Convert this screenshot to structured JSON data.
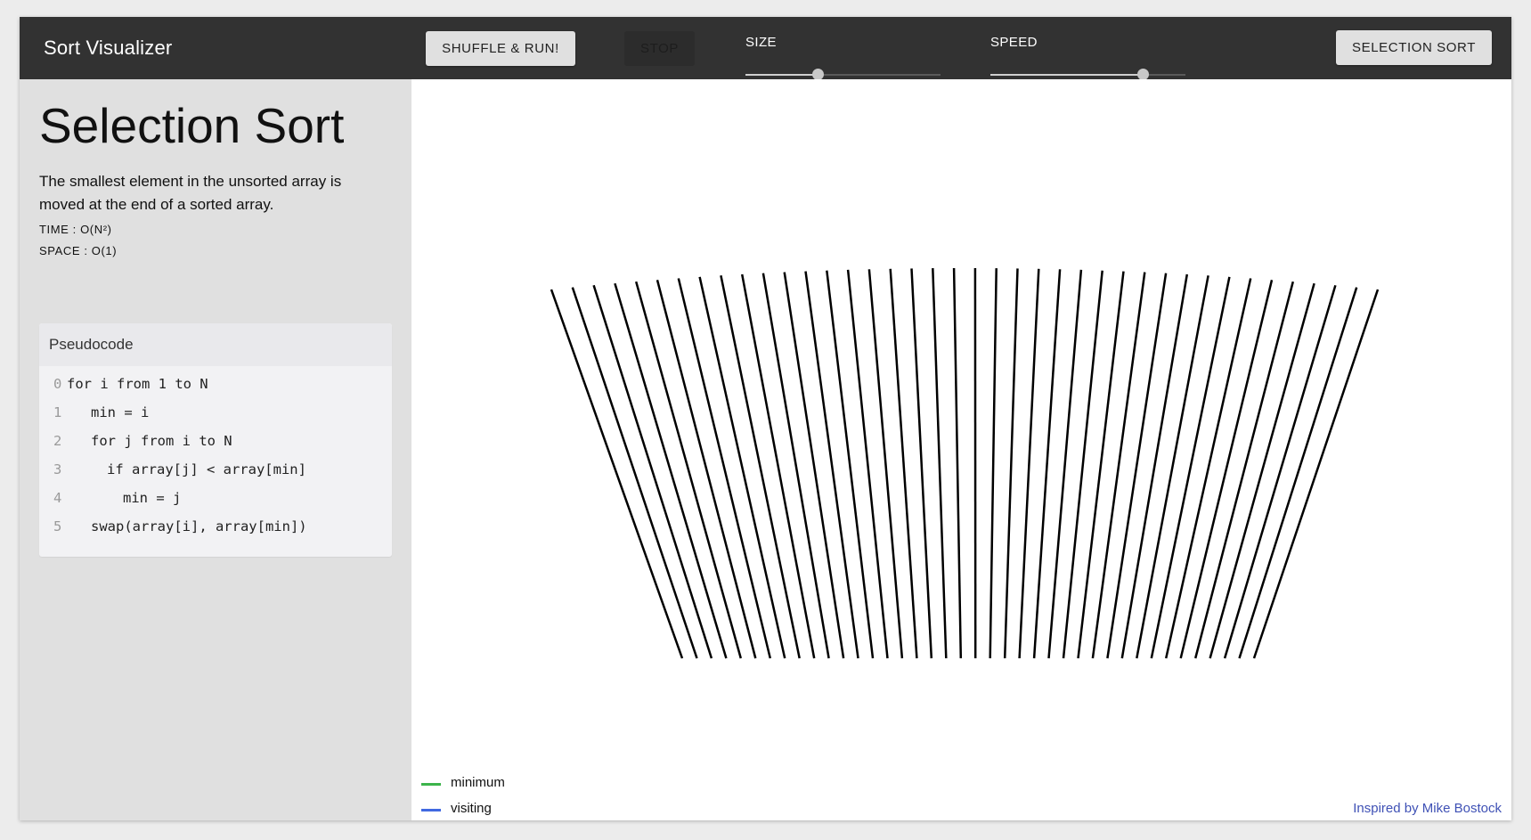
{
  "header": {
    "title": "Sort Visualizer",
    "shuffle_label": "SHUFFLE & RUN!",
    "stop_label": "STOP",
    "size_label": "SIZE",
    "speed_label": "SPEED",
    "algorithm_label": "SELECTION SORT"
  },
  "controls": {
    "size_level": 0.37,
    "speed_level": 0.78
  },
  "sidebar": {
    "name": "Selection Sort",
    "description": "The smallest element in the unsorted array is moved at the end of a sorted array.",
    "time": "TIME : O(N²)",
    "space": "SPACE : O(1)",
    "pseudocode": {
      "title": "Pseudocode",
      "lines": [
        {
          "no": "0",
          "code": "for i from 1 to N",
          "indent": 0
        },
        {
          "no": "1",
          "code": "min = i",
          "indent": 1
        },
        {
          "no": "2",
          "code": "for j from i to N",
          "indent": 1
        },
        {
          "no": "3",
          "code": "if array[j] < array[min]",
          "indent": 2
        },
        {
          "no": "4",
          "code": "min = j",
          "indent": 3
        },
        {
          "no": "5",
          "code": "swap(array[i], array[min])",
          "indent": 1
        }
      ]
    }
  },
  "visualization": {
    "line_count": 40,
    "line_color": "#000000",
    "legend": [
      {
        "label": "minimum",
        "color": "#3cb44b"
      },
      {
        "label": "visiting",
        "color": "#4169e1"
      }
    ],
    "credit": "Inspired by Mike Bostock"
  }
}
